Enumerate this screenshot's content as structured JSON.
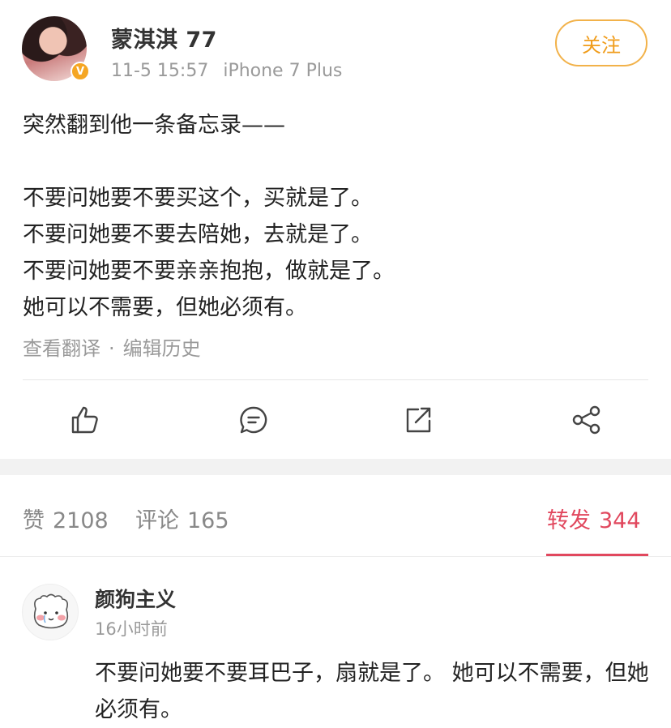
{
  "post": {
    "username": "蒙淇淇 77",
    "date": "11-5 15:57",
    "device": "iPhone 7 Plus",
    "follow_label": "关注",
    "verified_glyph": "V",
    "content_lines": [
      "突然翻到他一条备忘录——",
      "",
      "不要问她要不要买这个，买就是了。",
      "不要问她要不要去陪她，去就是了。",
      "不要问她要不要亲亲抱抱，做就是了。",
      "她可以不需要，但她必须有。"
    ],
    "translate_link": "查看翻译",
    "separator": "·",
    "history_link": "编辑历史",
    "actions": [
      "like-icon",
      "comment-icon",
      "repost-icon",
      "share-icon"
    ]
  },
  "tabs": [
    {
      "label": "赞",
      "count": "2108",
      "active": false
    },
    {
      "label": "评论",
      "count": "165",
      "active": false
    },
    {
      "label": "转发",
      "count": "344",
      "active": true
    }
  ],
  "comment": {
    "username": "颜狗主义",
    "time": "16小时前",
    "text": "不要问她要不要耳巴子，扇就是了。 她可以不需要，但她必须有。"
  },
  "colors": {
    "accent_red": "#e1485e",
    "follow_orange": "#f09c1a",
    "verified_yellow": "#f5a623",
    "muted_grey": "#9a9a9a"
  }
}
